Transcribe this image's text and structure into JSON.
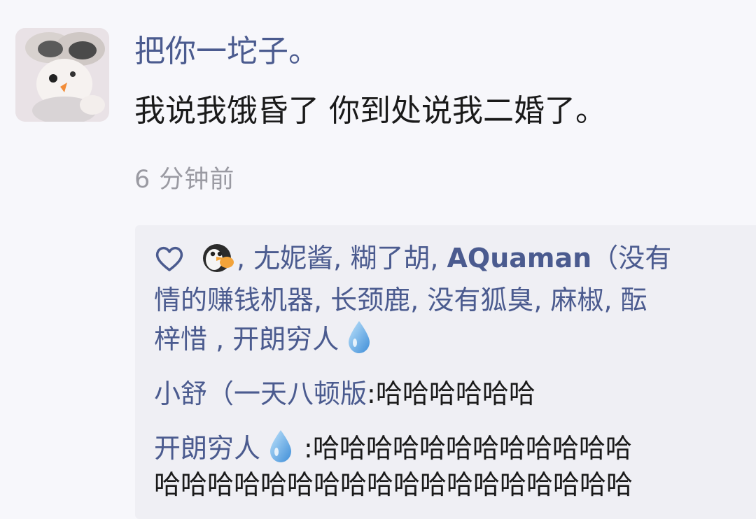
{
  "post": {
    "author": "把你一坨子。",
    "content": "我说我饿昏了 你到处说我二婚了。",
    "time": "6 分钟前"
  },
  "likes": {
    "heart_icon": "heart-outline-icon",
    "avatar_icon": "penguin-emoji-icon",
    "line1": ", 尢妮酱, 糊了胡, ",
    "line1_bold": "AQuaman",
    "line1_tail": "（没有",
    "line2": "情的赚钱机器, 长颈鹿, 没有狐臭, 麻椒, 酝",
    "line3": "梓惜 , 开朗穷人",
    "drop_icon": "droplet-emoji-icon"
  },
  "comments": [
    {
      "author": "小舒（一天八顿版",
      "separator": ":",
      "text": "哈哈哈哈哈哈"
    },
    {
      "author": "开朗穷人",
      "separator": ":",
      "text": "哈哈哈哈哈哈哈哈哈哈哈哈",
      "text_cont": "哈哈哈哈哈哈哈哈哈哈哈哈哈哈哈哈哈哈"
    }
  ],
  "colors": {
    "link": "#4b5b8f",
    "text": "#1a1a1a",
    "muted": "#9a9aa2",
    "background": "#f7f7fb",
    "comment_background": "#efeff4"
  }
}
